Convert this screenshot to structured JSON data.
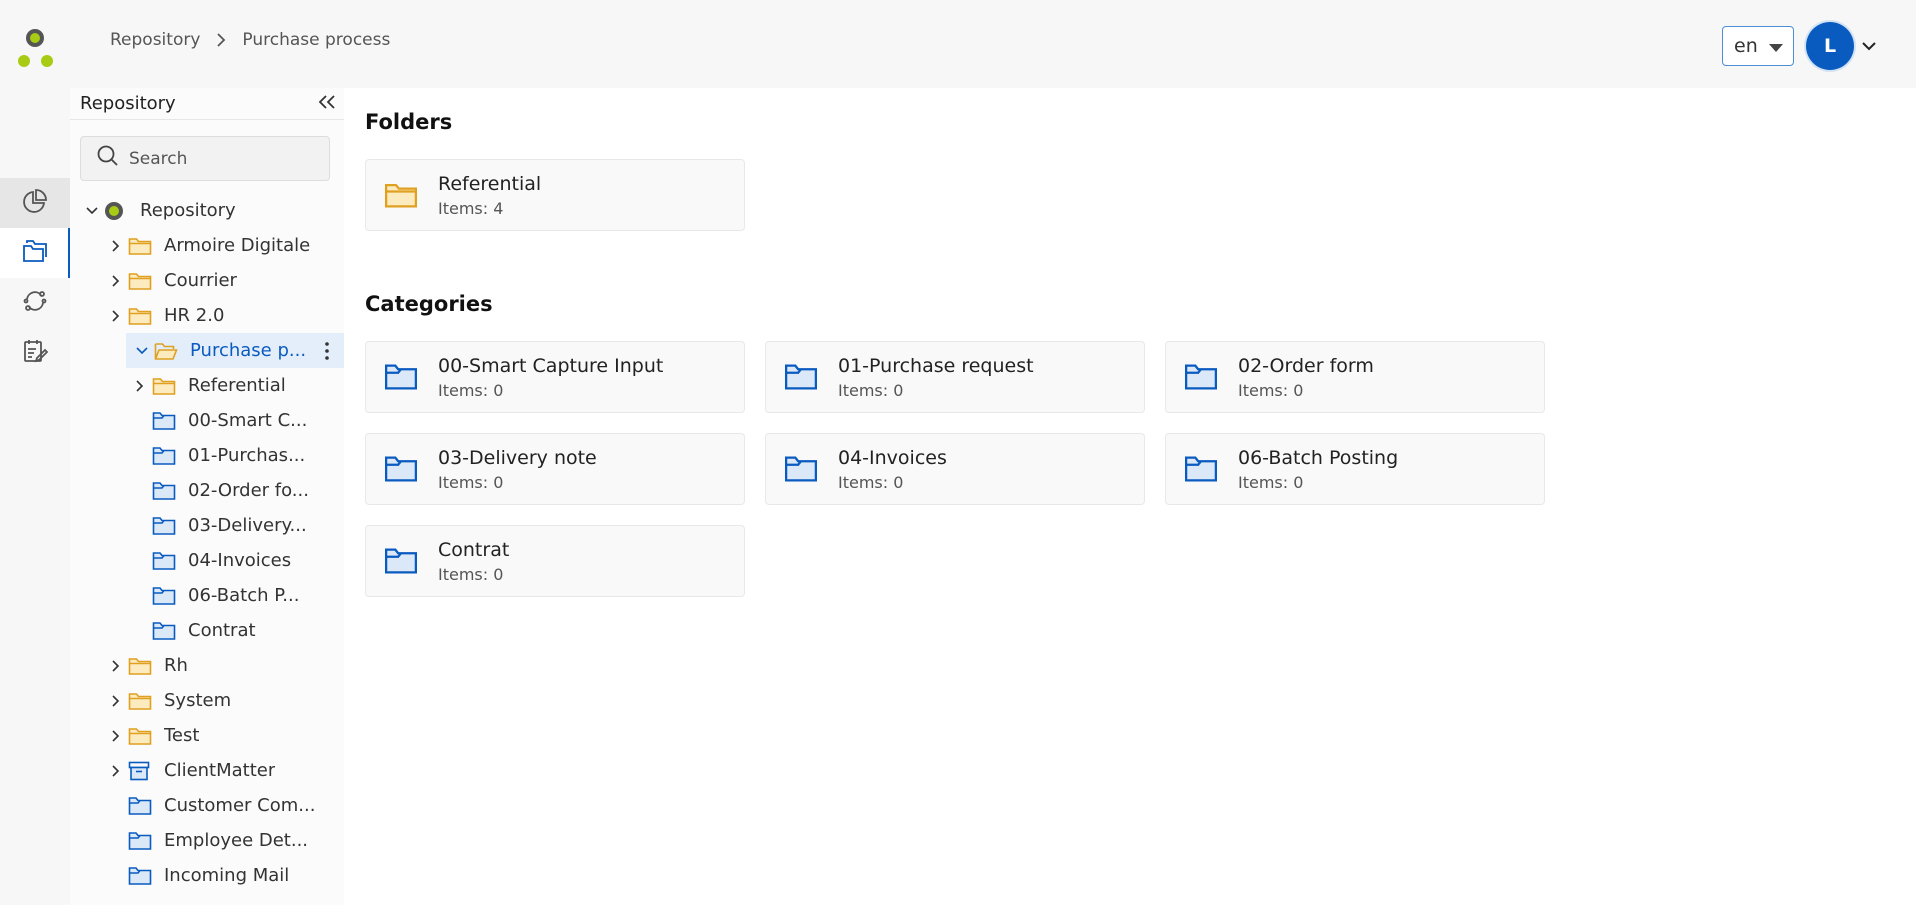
{
  "breadcrumb": [
    "Repository",
    "Purchase process"
  ],
  "language": {
    "value": "en"
  },
  "user": {
    "initial": "L"
  },
  "rail": [
    {
      "name": "dashboard-icon"
    },
    {
      "name": "repository-icon"
    },
    {
      "name": "workflow-icon"
    },
    {
      "name": "tasks-icon"
    }
  ],
  "tree_panel": {
    "title": "Repository",
    "search_placeholder": "Search",
    "items": [
      {
        "label": "Repository",
        "level": 0,
        "expander": "open",
        "icon": "repo"
      },
      {
        "label": "Armoire Digitale",
        "level": 1,
        "expander": "closed",
        "icon": "folder"
      },
      {
        "label": "Courrier",
        "level": 1,
        "expander": "closed",
        "icon": "folder"
      },
      {
        "label": "HR 2.0",
        "level": 1,
        "expander": "closed",
        "icon": "folder"
      },
      {
        "label": "Purchase p...",
        "level": 1,
        "expander": "open",
        "icon": "folder-open",
        "selected": true
      },
      {
        "label": "Referential",
        "level": 2,
        "expander": "closed",
        "icon": "folder"
      },
      {
        "label": "00-Smart C...",
        "level": 2,
        "expander": "none",
        "icon": "category"
      },
      {
        "label": "01-Purchas...",
        "level": 2,
        "expander": "none",
        "icon": "category"
      },
      {
        "label": "02-Order fo...",
        "level": 2,
        "expander": "none",
        "icon": "category"
      },
      {
        "label": "03-Delivery...",
        "level": 2,
        "expander": "none",
        "icon": "category"
      },
      {
        "label": "04-Invoices",
        "level": 2,
        "expander": "none",
        "icon": "category"
      },
      {
        "label": "06-Batch P...",
        "level": 2,
        "expander": "none",
        "icon": "category"
      },
      {
        "label": "Contrat",
        "level": 2,
        "expander": "none",
        "icon": "category"
      },
      {
        "label": "Rh",
        "level": 1,
        "expander": "closed",
        "icon": "folder"
      },
      {
        "label": "System",
        "level": 1,
        "expander": "closed",
        "icon": "folder"
      },
      {
        "label": "Test",
        "level": 1,
        "expander": "closed",
        "icon": "folder"
      },
      {
        "label": "ClientMatter",
        "level": 1,
        "expander": "closed",
        "icon": "archive"
      },
      {
        "label": "Customer Com...",
        "level": 1,
        "expander": "none",
        "icon": "category"
      },
      {
        "label": "Employee Det...",
        "level": 1,
        "expander": "none",
        "icon": "category"
      },
      {
        "label": "Incoming Mail",
        "level": 1,
        "expander": "none",
        "icon": "category"
      }
    ]
  },
  "main": {
    "folders_title": "Folders",
    "folders": [
      {
        "name": "Referential",
        "count": "Items: 4"
      }
    ],
    "categories_title": "Categories",
    "categories": [
      {
        "name": "00-Smart Capture Input",
        "count": "Items: 0"
      },
      {
        "name": "01-Purchase request",
        "count": "Items: 0"
      },
      {
        "name": "02-Order form",
        "count": "Items: 0"
      },
      {
        "name": "03-Delivery note",
        "count": "Items: 0"
      },
      {
        "name": "04-Invoices",
        "count": "Items: 0"
      },
      {
        "name": "06-Batch Posting",
        "count": "Items: 0"
      },
      {
        "name": "Contrat",
        "count": "Items: 0"
      }
    ]
  },
  "colors": {
    "accent": "#0a5bbf",
    "folder_fill": "#fdebc0",
    "folder_stroke": "#e0a020",
    "category_fill": "#dbe8f8",
    "logo_dot": "#a8cc14",
    "logo_dark": "#555555"
  }
}
